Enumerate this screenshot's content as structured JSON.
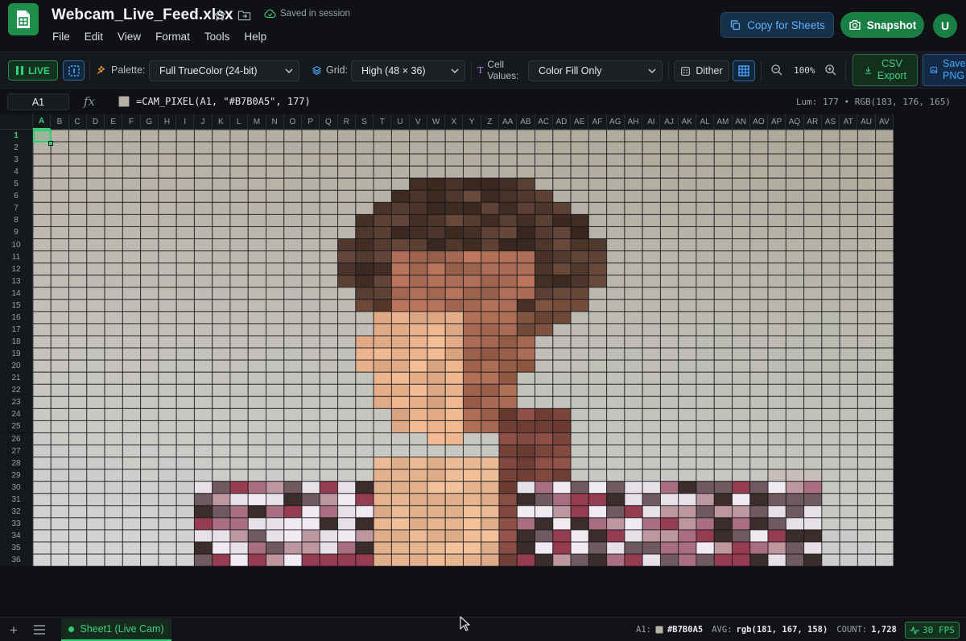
{
  "header": {
    "doc_title": "Webcam_Live_Feed.xlsx",
    "saved_status": "Saved in session",
    "menu": [
      "File",
      "Edit",
      "View",
      "Format",
      "Tools",
      "Help"
    ],
    "copy_button": "Copy for Sheets",
    "snapshot_button": "Snapshot",
    "avatar_initial": "U"
  },
  "toolbar": {
    "live_label": "LIVE",
    "palette_label": "Palette:",
    "palette_value": "Full TrueColor (24-bit)",
    "grid_label": "Grid:",
    "grid_value": "High (48 × 36)",
    "cell_values_label_line1": "Cell",
    "cell_values_label_line2": "Values:",
    "cell_values_value": "Color Fill Only",
    "dither_label": "Dither",
    "zoom_level": "100%",
    "csv_export_line1": "CSV",
    "csv_export_line2": "Export",
    "save_png_line1": "Save",
    "save_png_line2": "PNG"
  },
  "formula_bar": {
    "cell_ref": "A1",
    "fx": "fx",
    "swatch_color": "#B7B0A5",
    "formula": "=CAM_PIXEL(A1, \"#B7B0A5\", 177)",
    "lum_info": "Lum: 177 • RGB(183, 176, 165)"
  },
  "sheet": {
    "columns": [
      "A",
      "B",
      "C",
      "D",
      "E",
      "F",
      "G",
      "H",
      "I",
      "J",
      "K",
      "L",
      "M",
      "N",
      "O",
      "P",
      "Q",
      "R",
      "S",
      "T",
      "U",
      "V",
      "W",
      "X",
      "Y",
      "Z",
      "AA",
      "AB",
      "AC",
      "AD",
      "AE",
      "AF",
      "AG",
      "AH",
      "AI",
      "AJ",
      "AK",
      "AL",
      "AM",
      "AN",
      "AO",
      "AP",
      "AQ",
      "AR",
      "AS",
      "AT",
      "AU",
      "AV"
    ],
    "rows": [
      1,
      2,
      3,
      4,
      5,
      6,
      7,
      8,
      9,
      10,
      11,
      12,
      13,
      14,
      15,
      16,
      17,
      18,
      19,
      20,
      21,
      22,
      23,
      24,
      25,
      26,
      27,
      28,
      29,
      30,
      31,
      32,
      33,
      34,
      35,
      36
    ],
    "active_column": "A",
    "active_row": 1
  },
  "bottom": {
    "add_sheet": "+",
    "sheet_tab": "Sheet1 (Live Cam)",
    "status_cell": "A1:",
    "status_hex": "#B7B0A5",
    "status_avg_label": "AVG:",
    "status_avg": "rgb(181, 167, 158)",
    "status_count_label": "COUNT:",
    "status_count": "1,728",
    "fps": "30 FPS"
  },
  "colors": {
    "accent_green": "#2ecf73",
    "accent_blue": "#4aa8ff",
    "background": "#0e1013"
  },
  "icons": [
    "sheets-app-icon",
    "star-icon",
    "folder-move-icon",
    "cloud-check-icon",
    "copy-icon",
    "camera-icon",
    "pause-icon",
    "select-region-icon",
    "palette-icon",
    "layers-icon",
    "text-t-icon",
    "chevron-down-icon",
    "dither-icon",
    "grid-icon",
    "zoom-out-icon",
    "zoom-in-icon",
    "download-icon",
    "image-icon",
    "plus-icon",
    "menu-icon",
    "pulse-icon",
    "mouse-cursor-icon"
  ]
}
